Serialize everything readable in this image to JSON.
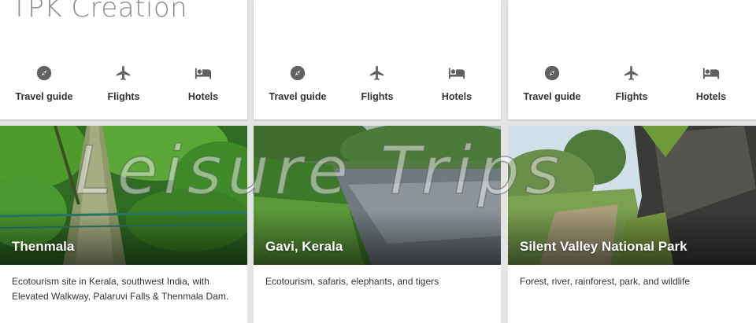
{
  "brand": "TPK Creation",
  "watermark": "Leisure Trips",
  "cards": [
    {
      "actions": [
        {
          "icon": "compass-icon",
          "label": "Travel guide"
        },
        {
          "icon": "airplane-icon",
          "label": "Flights"
        },
        {
          "icon": "bed-icon",
          "label": "Hotels"
        }
      ],
      "title": "Thenmala",
      "description": "Ecotourism site in Kerala, southwest India, with Elevated Walkway, Palaruvi Falls & Thenmala Dam."
    },
    {
      "actions": [
        {
          "icon": "compass-icon",
          "label": "Travel guide"
        },
        {
          "icon": "airplane-icon",
          "label": "Flights"
        },
        {
          "icon": "bed-icon",
          "label": "Hotels"
        }
      ],
      "title": "Gavi, Kerala",
      "description": "Ecotourism, safaris, elephants, and tigers"
    },
    {
      "actions": [
        {
          "icon": "compass-icon",
          "label": "Travel guide"
        },
        {
          "icon": "airplane-icon",
          "label": "Flights"
        },
        {
          "icon": "bed-icon",
          "label": "Hotels"
        }
      ],
      "title": "Silent Valley National Park",
      "description": "Forest, river, rainforest, park, and wildlife"
    }
  ],
  "colors": {
    "icon": "#616161",
    "text": "#333333",
    "background": "#e4e4e4"
  }
}
